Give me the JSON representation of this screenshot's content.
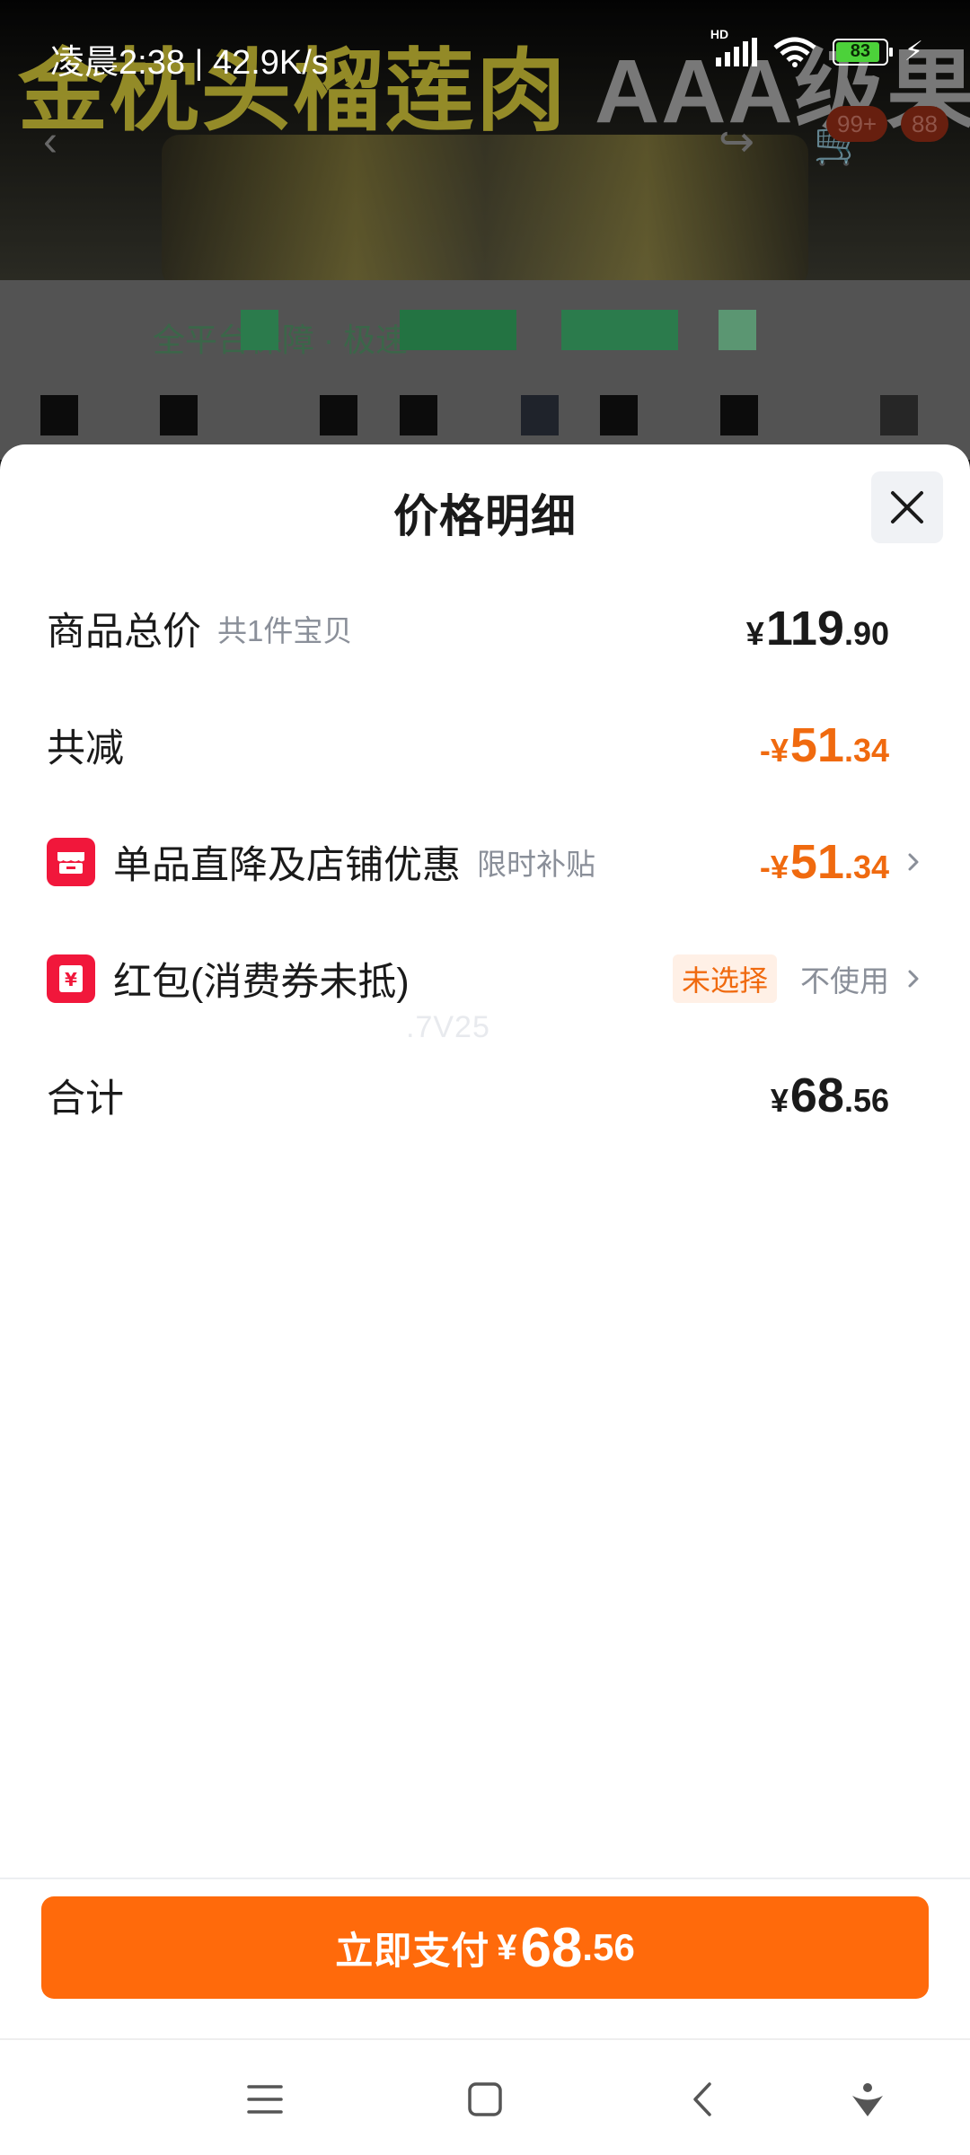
{
  "background": {
    "banner_text": "金枕头榴莲肉",
    "banner_sub": "AAA级果肉",
    "cart_badge": "99+",
    "badge2": "88",
    "notice_text": "全平台保障 · 极速"
  },
  "status_bar": {
    "time_speed": "凌晨2:38 | 42.9K/s",
    "hd": "HD",
    "battery": "83"
  },
  "sheet": {
    "title": "价格明细",
    "watermark": ".7V25",
    "rows": {
      "total_goods": {
        "label": "商品总价",
        "sublabel": "共1件宝贝",
        "currency": "¥",
        "price_int": "119",
        "price_dec": ".90"
      },
      "discount_total": {
        "label": "共减",
        "currency": "-¥",
        "price_int": "51",
        "price_dec": ".34"
      },
      "store_discount": {
        "label": "单品直降及店铺优惠",
        "sublabel": "限时补贴",
        "currency": "-¥",
        "price_int": "51",
        "price_dec": ".34",
        "icon": "store-icon"
      },
      "red_packet": {
        "label": "红包(消费券未抵)",
        "tag": "未选择",
        "value": "不使用",
        "icon": "red-packet-icon"
      },
      "sum": {
        "label": "合计",
        "currency": "¥",
        "price_int": "68",
        "price_dec": ".56"
      }
    }
  },
  "footer": {
    "pay_label": "立即支付",
    "currency": "¥",
    "price_int": "68",
    "price_dec": ".56"
  },
  "colors": {
    "accent_orange": "#ff6a0b",
    "price_orange": "#f06a0f",
    "icon_red": "#f1173b"
  }
}
